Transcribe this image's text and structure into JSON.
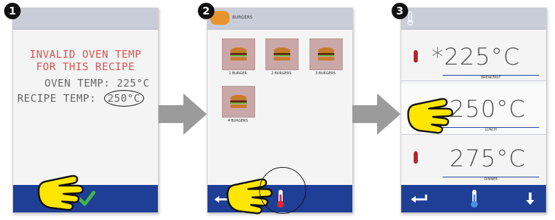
{
  "steps": [
    {
      "number": "1"
    },
    {
      "number": "2"
    },
    {
      "number": "3"
    }
  ],
  "screen1": {
    "error_line1": "INVALID OVEN TEMP",
    "error_line2": "FOR THIS RECIPE",
    "oven_temp": "OVEN TEMP: 225°C",
    "recipe_temp_label": "RECIPE TEMP:",
    "recipe_temp_value": "250°C",
    "confirm_icon": "checkmark-icon"
  },
  "screen2": {
    "header_title": "BURGERS",
    "items": [
      {
        "label": "1 BURGER"
      },
      {
        "label": "2 BURGERS"
      },
      {
        "label": "3 BURGERS"
      },
      {
        "label": "4 BURGERS"
      }
    ]
  },
  "screen3": {
    "rows": [
      {
        "value": "*225°C",
        "label": "BREAKFAST"
      },
      {
        "value": "250°C",
        "label": "LUNCH"
      },
      {
        "value": "275°C",
        "label": "DINNER"
      }
    ]
  },
  "colors": {
    "bottom_bar": "#1f3f97",
    "error_red": "#d9534f",
    "check_green": "#3fb54a",
    "hand_yellow": "#ffe600"
  }
}
